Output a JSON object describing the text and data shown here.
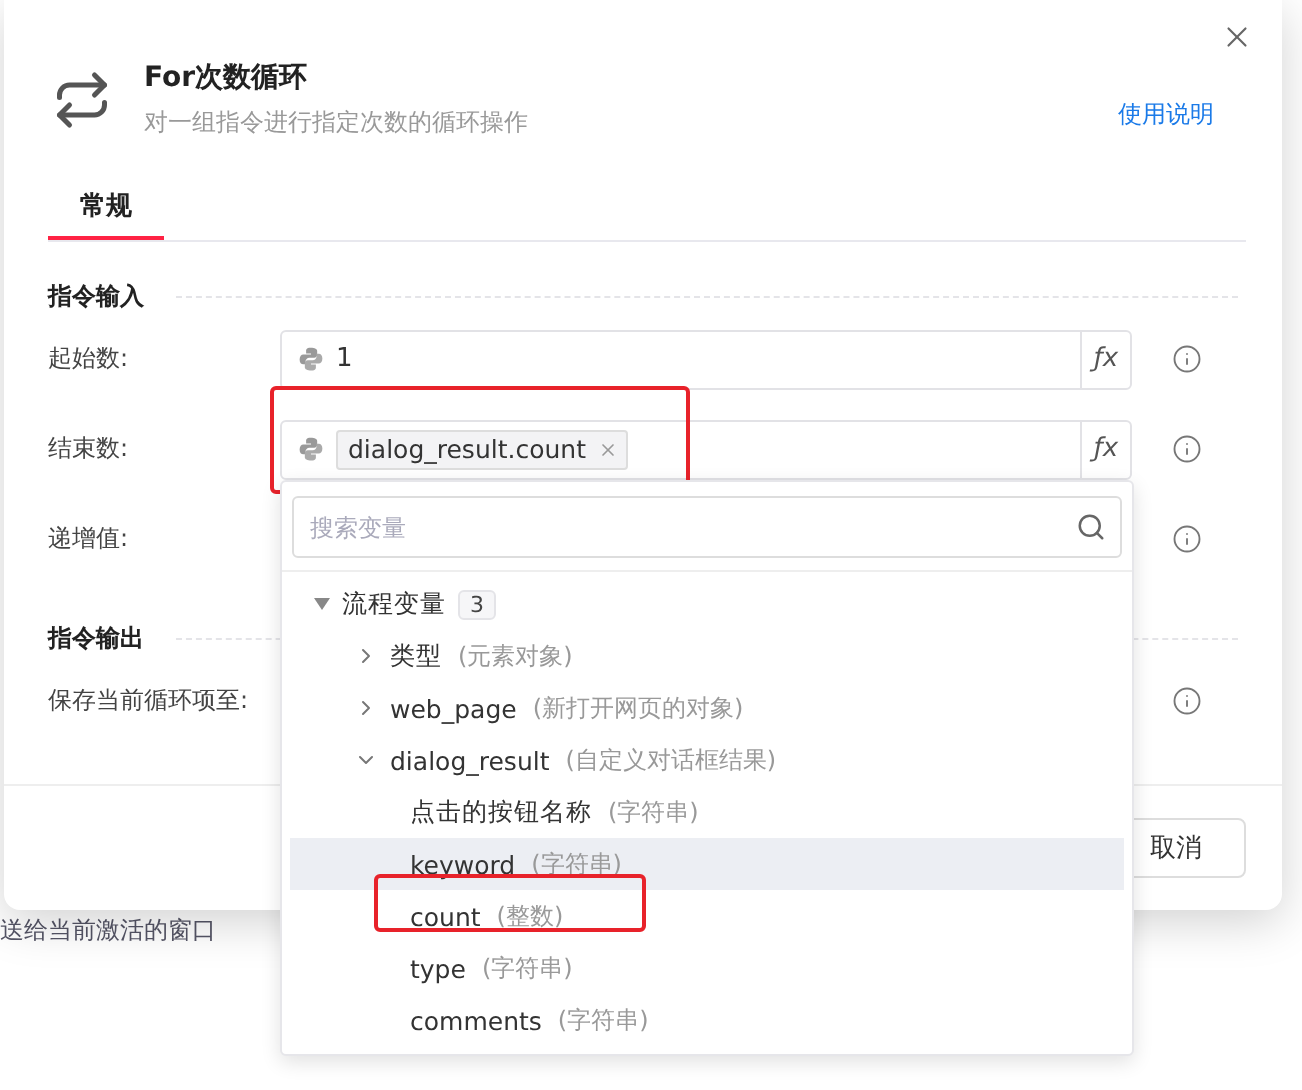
{
  "dialog": {
    "title": "For次数循环",
    "subtitle": "对一组指令进行指定次数的循环操作",
    "help_link": "使用说明",
    "tabs": [
      {
        "label": "常规",
        "selected": true
      }
    ],
    "sections": [
      {
        "title": "指令输入",
        "fields": [
          {
            "label": "起始数:",
            "kind": "text",
            "value": "1",
            "fx": "ƒx"
          },
          {
            "label": "结束数:",
            "kind": "tag",
            "value": "dialog_result.count",
            "fx": "ƒx",
            "highlighted": true
          },
          {
            "label": "递增值:",
            "kind": "empty"
          }
        ]
      },
      {
        "title": "指令输出",
        "fields": [
          {
            "label": "保存当前循环项至:",
            "kind": "empty"
          }
        ]
      }
    ],
    "buttons": [
      {
        "label": "取消"
      }
    ]
  },
  "background_text": "送给当前激活的窗口",
  "dropdown": {
    "search_placeholder": "搜索变量",
    "tree": {
      "label": "流程变量",
      "count": "3",
      "expanded": true,
      "children": [
        {
          "name": "类型",
          "type": "(元素对象)",
          "expanded": false
        },
        {
          "name": "web_page",
          "type": "(新打开网页的对象)",
          "expanded": false
        },
        {
          "name": "dialog_result",
          "type": "(自定义对话框结果)",
          "expanded": true,
          "children": [
            {
              "name": "点击的按钮名称",
              "type": "(字符串)",
              "hovered": false
            },
            {
              "name": "keyword",
              "type": "(字符串)",
              "hovered": true
            },
            {
              "name": "count",
              "type": "(整数)",
              "hovered": false,
              "highlighted": true
            },
            {
              "name": "type",
              "type": "(字符串)",
              "hovered": false
            },
            {
              "name": "comments",
              "type": "(字符串)",
              "hovered": false
            }
          ]
        }
      ]
    }
  }
}
